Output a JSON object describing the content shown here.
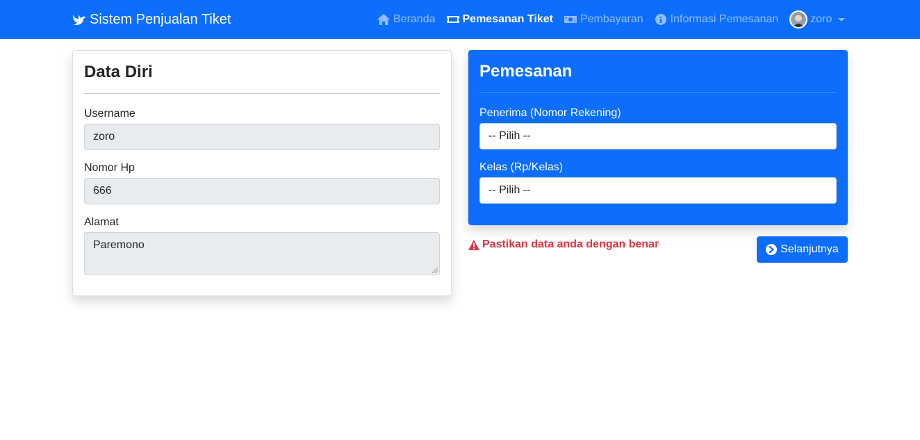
{
  "navbar": {
    "brand": "Sistem Penjualan Tiket",
    "items": [
      {
        "label": "Beranda",
        "icon": "home-icon",
        "active": false
      },
      {
        "label": "Pemesanan Tiket",
        "icon": "ticket-icon",
        "active": true
      },
      {
        "label": "Pembayaran",
        "icon": "money-icon",
        "active": false
      },
      {
        "label": "Informasi Pemesanan",
        "icon": "info-icon",
        "active": false
      }
    ],
    "user": "zoro"
  },
  "data_diri": {
    "title": "Data Diri",
    "username_label": "Username",
    "username_value": "zoro",
    "phone_label": "Nomor Hp",
    "phone_value": "666",
    "address_label": "Alamat",
    "address_value": "Paremono"
  },
  "pemesanan": {
    "title": "Pemesanan",
    "recipient_label": "Penerima (Nomor Rekening)",
    "recipient_selected": "-- Pilih --",
    "class_label": "Kelas (Rp/Kelas)",
    "class_selected": "-- Pilih --"
  },
  "warning": "Pastikan data anda dengan benar",
  "next_button": "Selanjutnya",
  "colors": {
    "primary": "#0d6efd",
    "danger": "#dc3545",
    "readonly_bg": "#e9ecef"
  }
}
